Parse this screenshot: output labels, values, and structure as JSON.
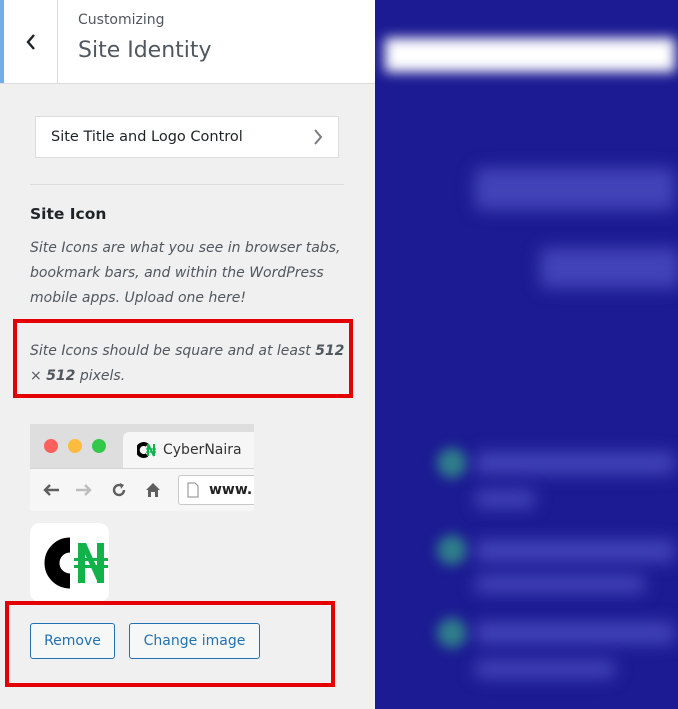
{
  "header": {
    "subtitle": "Customizing",
    "title": "Site Identity"
  },
  "nav": {
    "site_title_logo": "Site Title and Logo Control"
  },
  "site_icon": {
    "section_title": "Site Icon",
    "description": "Site Icons are what you see in browser tabs, bookmark bars, and within the WordPress mobile apps. Upload one here!",
    "note_prefix": "Site Icons should be square and at least ",
    "note_size_1": "512",
    "note_times": " × ",
    "note_size_2": "512",
    "note_suffix": " pixels.",
    "browser_tab_label": "CyberNaira",
    "browser_url": "www.",
    "logo_text": "CN"
  },
  "buttons": {
    "remove": "Remove",
    "change_image": "Change image"
  },
  "colors": {
    "accent": "#2271b1",
    "highlight": "#e40000",
    "preview_bg": "#1c1b93"
  }
}
